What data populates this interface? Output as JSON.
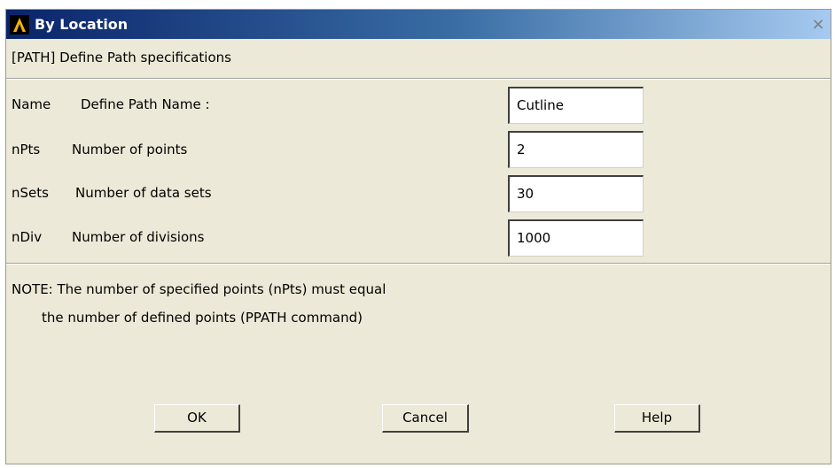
{
  "window": {
    "title": "By Location",
    "close_glyph": "×",
    "header": "[PATH]  Define Path specifications"
  },
  "fields": [
    {
      "code": "Name",
      "label": "Define Path Name :",
      "value": "Cutline"
    },
    {
      "code": "nPts",
      "label": "Number of points",
      "value": "2"
    },
    {
      "code": "nSets",
      "label": "Number of data sets",
      "value": "30"
    },
    {
      "code": "nDiv",
      "label": "Number of divisions",
      "value": "1000"
    }
  ],
  "note": {
    "line1": "NOTE: The number of specified points (nPts) must equal",
    "line2": "the number of defined points (PPATH command)"
  },
  "buttons": {
    "ok": "OK",
    "cancel": "Cancel",
    "help": "Help"
  },
  "icons": {
    "app": "ansys-logo-icon",
    "close": "close-icon"
  }
}
